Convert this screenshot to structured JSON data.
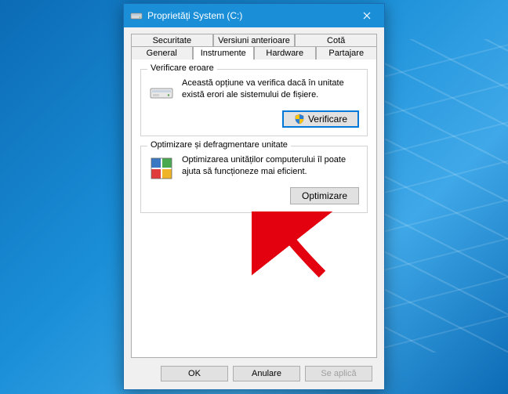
{
  "window": {
    "title": "Proprietăți System (C:)"
  },
  "tabs": {
    "row1": [
      {
        "label": "Securitate"
      },
      {
        "label": "Versiuni anterioare"
      },
      {
        "label": "Cotă"
      }
    ],
    "row2": [
      {
        "label": "General"
      },
      {
        "label": "Instrumente",
        "active": true
      },
      {
        "label": "Hardware"
      },
      {
        "label": "Partajare"
      }
    ]
  },
  "groups": {
    "error_check": {
      "title": "Verificare eroare",
      "desc": "Această opțiune va verifica dacă în unitate există erori ale sistemului de fișiere.",
      "button": "Verificare"
    },
    "optimize": {
      "title": "Optimizare și defragmentare unitate",
      "desc": "Optimizarea unităților computerului îl poate ajuta să funcționeze mai eficient.",
      "button": "Optimizare"
    }
  },
  "footer": {
    "ok": "OK",
    "cancel": "Anulare",
    "apply": "Se aplică"
  }
}
